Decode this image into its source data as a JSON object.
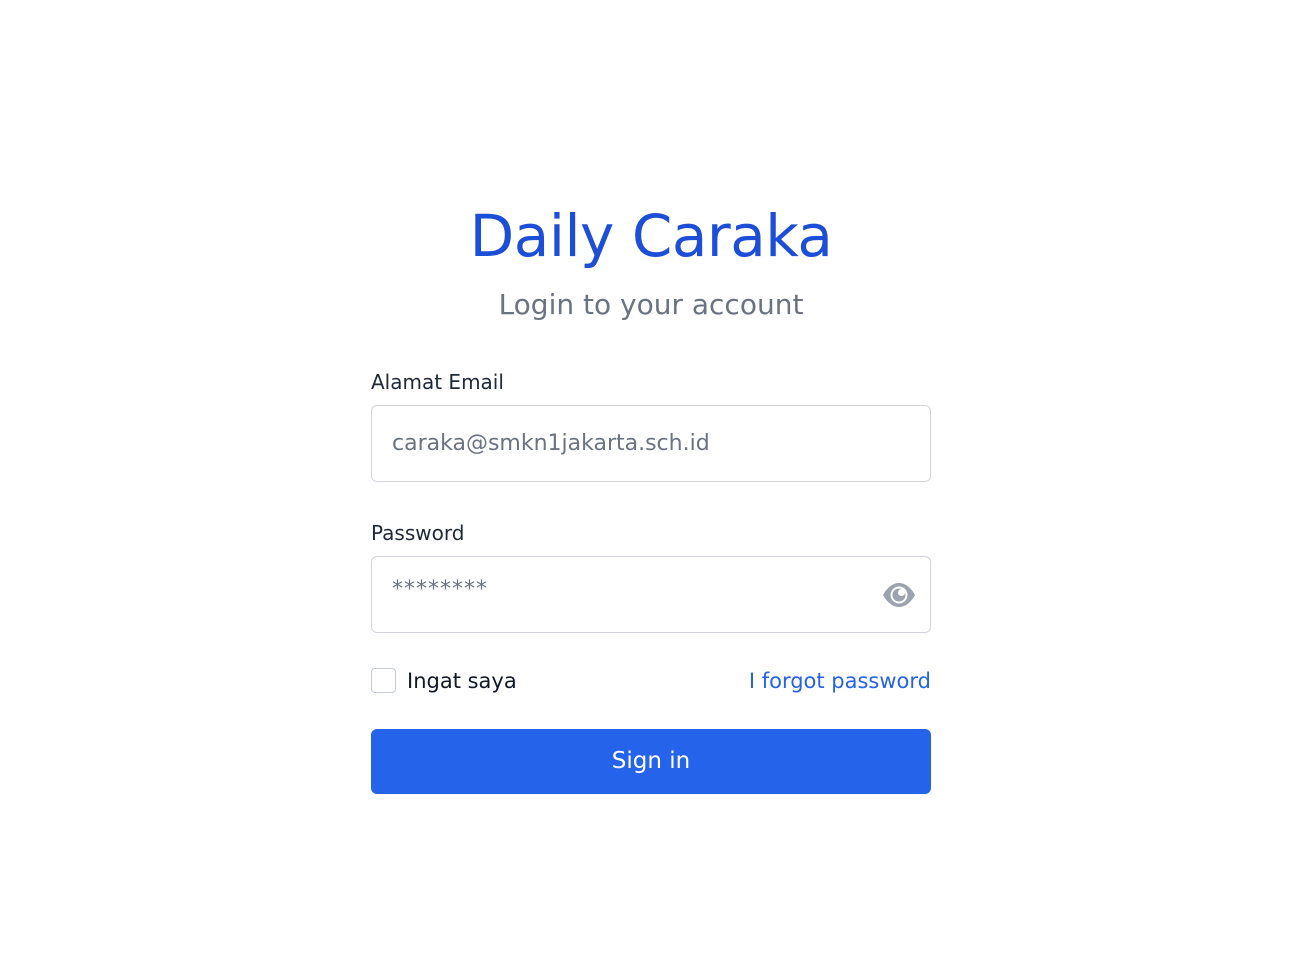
{
  "app": {
    "title": "Daily Caraka",
    "subtitle": "Login to your account"
  },
  "form": {
    "email_label": "Alamat Email",
    "email_value": "caraka@smkn1jakarta.sch.id",
    "password_label": "Password",
    "password_value": "********",
    "remember_label": "Ingat saya",
    "remember_checked": false,
    "forgot_label": "I forgot password",
    "submit_label": "Sign in"
  },
  "icons": {
    "password_toggle": "eye-icon"
  },
  "colors": {
    "brand": "#1d4ed8",
    "accent": "#2563eb",
    "muted_text": "#6b7280",
    "border": "#d1d5db"
  }
}
